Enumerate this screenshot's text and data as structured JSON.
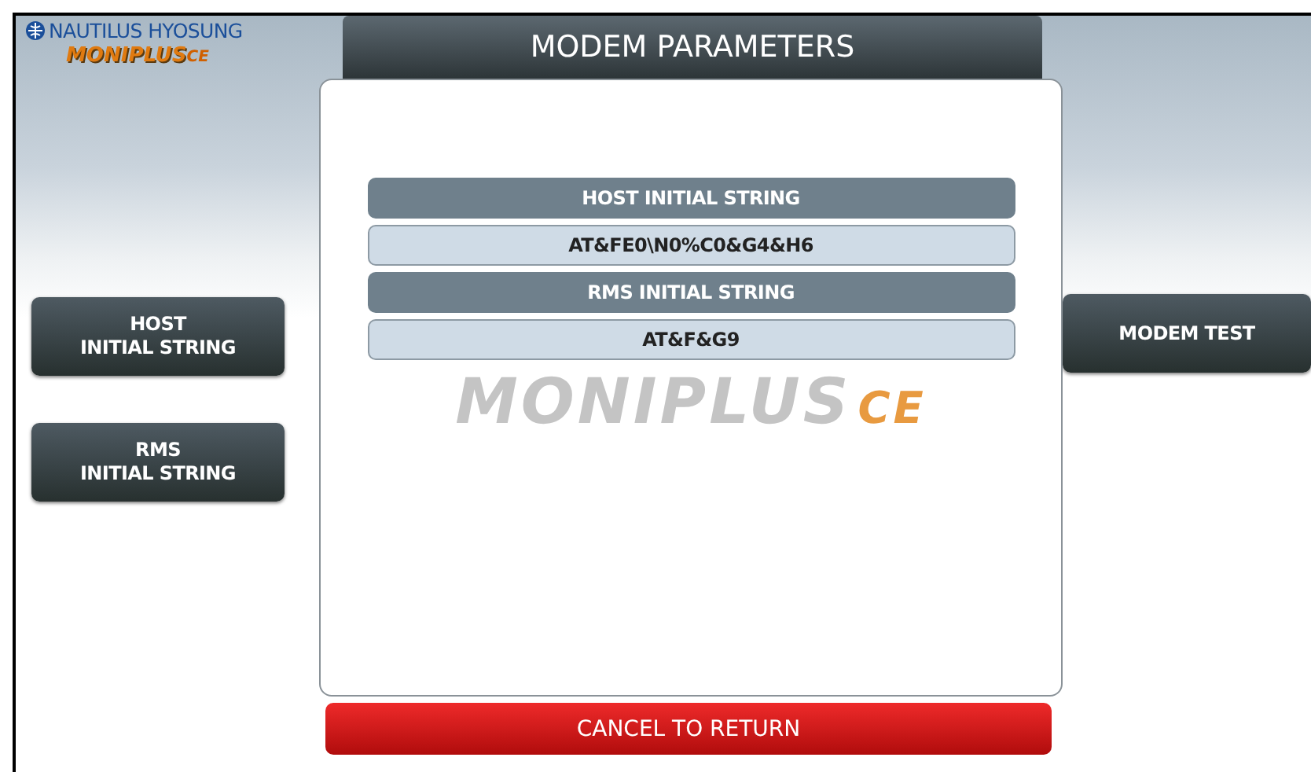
{
  "brand": {
    "company": "NAUTILUS HYOSUNG",
    "product": "MONIPLUS",
    "edition": "CE"
  },
  "title": "MODEM PARAMETERS",
  "left_buttons": [
    {
      "lines": [
        "HOST",
        "INITIAL STRING"
      ]
    },
    {
      "lines": [
        "RMS",
        "INITIAL STRING"
      ]
    }
  ],
  "right_buttons": [
    {
      "lines": [
        "MODEM TEST"
      ]
    }
  ],
  "fields": [
    {
      "kind": "header",
      "text": "HOST INITIAL STRING"
    },
    {
      "kind": "value",
      "text": "AT&FE0\\N0%C0&G4&H6"
    },
    {
      "kind": "header",
      "text": "RMS INITIAL STRING"
    },
    {
      "kind": "value",
      "text": "AT&F&G9"
    }
  ],
  "watermark": {
    "product": "MONIPLUS",
    "edition": "CE"
  },
  "cancel_button": "CANCEL TO RETURN"
}
